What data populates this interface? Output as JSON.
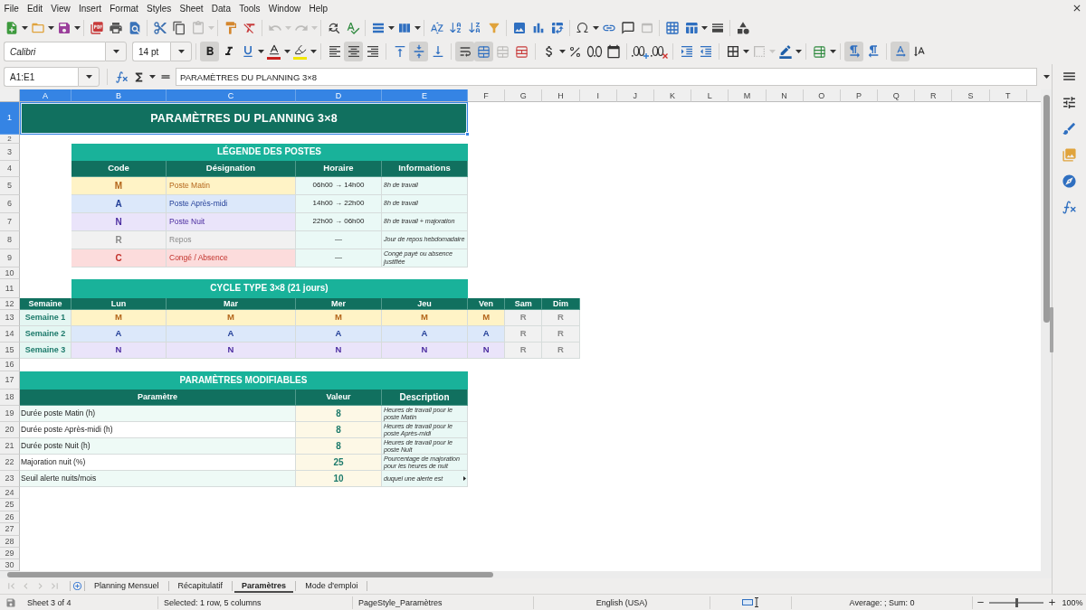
{
  "menu_bar": [
    "File",
    "Edit",
    "View",
    "Insert",
    "Format",
    "Styles",
    "Sheet",
    "Data",
    "Tools",
    "Window",
    "Help"
  ],
  "standard_toolbar": [
    [
      {
        "kind": "new",
        "disabled": false
      },
      {
        "kind": "open",
        "disabled": false
      },
      {
        "kind": "save",
        "disabled": false
      }
    ],
    [
      {
        "kind": "export_pdf",
        "disabled": false
      },
      {
        "kind": "print",
        "disabled": false
      },
      {
        "kind": "print_preview",
        "disabled": false
      }
    ],
    [
      {
        "kind": "cut",
        "disabled": false
      },
      {
        "kind": "copy",
        "disabled": false
      },
      {
        "kind": "paste",
        "disabled": true
      }
    ],
    [
      {
        "kind": "clone_formatting",
        "disabled": false
      },
      {
        "kind": "clear_formatting",
        "disabled": false
      }
    ],
    [
      {
        "kind": "undo",
        "disabled": true
      },
      {
        "kind": "redo",
        "disabled": true
      }
    ],
    [
      {
        "kind": "find_replace",
        "disabled": false
      },
      {
        "kind": "spelling",
        "disabled": false
      }
    ],
    [
      {
        "kind": "row",
        "disabled": false
      },
      {
        "kind": "column",
        "disabled": false
      }
    ],
    [
      {
        "kind": "sort",
        "disabled": false
      },
      {
        "kind": "sort_ascending",
        "disabled": false
      },
      {
        "kind": "sort_descending",
        "disabled": false
      },
      {
        "kind": "autofilter",
        "disabled": false
      }
    ],
    [
      {
        "kind": "image",
        "disabled": false
      },
      {
        "kind": "chart",
        "disabled": false
      },
      {
        "kind": "pivot_table",
        "disabled": false
      }
    ],
    [
      {
        "kind": "special_character",
        "disabled": false
      },
      {
        "kind": "hyperlink",
        "disabled": false
      },
      {
        "kind": "comment",
        "disabled": false
      },
      {
        "kind": "header_footer",
        "disabled": true
      }
    ],
    [
      {
        "kind": "print_area",
        "disabled": false
      },
      {
        "kind": "freeze",
        "disabled": false
      },
      {
        "kind": "split_window",
        "disabled": false
      }
    ],
    [
      {
        "kind": "draw_functions",
        "disabled": false
      }
    ]
  ],
  "formatting_toolbar": {
    "font_name": "Calibri",
    "font_size": "14 pt",
    "tools": [
      [
        {
          "kind": "bold",
          "on": true,
          "disabled": false
        },
        {
          "kind": "italic",
          "on": false,
          "disabled": false
        },
        {
          "kind": "underline",
          "on": false,
          "disabled": false
        },
        {
          "kind": "font_color",
          "on": false,
          "disabled": false
        },
        {
          "kind": "highlight",
          "on": false,
          "disabled": false
        }
      ],
      [
        {
          "kind": "align_left",
          "on": false,
          "disabled": false
        },
        {
          "kind": "align_center",
          "on": true,
          "disabled": false
        },
        {
          "kind": "align_right",
          "on": false,
          "disabled": false
        }
      ],
      [
        {
          "kind": "align_top",
          "on": false,
          "disabled": false
        },
        {
          "kind": "align_middle",
          "on": true,
          "disabled": false
        },
        {
          "kind": "align_bottom",
          "on": false,
          "disabled": false
        }
      ],
      [
        {
          "kind": "wrap_text",
          "on": true,
          "disabled": false
        },
        {
          "kind": "merge_center",
          "on": true,
          "disabled": false
        },
        {
          "kind": "merge_cells",
          "on": false,
          "disabled": true
        },
        {
          "kind": "unmerge_cells",
          "on": false,
          "disabled": false
        }
      ],
      [
        {
          "kind": "currency",
          "on": false,
          "disabled": false
        },
        {
          "kind": "percent",
          "on": false,
          "disabled": false
        },
        {
          "kind": "number",
          "on": false,
          "disabled": false
        },
        {
          "kind": "date",
          "on": false,
          "disabled": false
        }
      ],
      [
        {
          "kind": "add_decimal",
          "on": false,
          "disabled": false
        },
        {
          "kind": "delete_decimal",
          "on": false,
          "disabled": false
        }
      ],
      [
        {
          "kind": "increase_indent",
          "on": false,
          "disabled": false
        },
        {
          "kind": "decrease_indent",
          "on": false,
          "disabled": false
        }
      ],
      [
        {
          "kind": "borders",
          "on": false,
          "disabled": false
        },
        {
          "kind": "border_style",
          "on": false,
          "disabled": true
        },
        {
          "kind": "border_color",
          "on": false,
          "disabled": false
        }
      ],
      [
        {
          "kind": "conditional",
          "on": false,
          "disabled": false
        }
      ],
      [
        {
          "kind": "left_to_right",
          "on": true,
          "disabled": false
        },
        {
          "kind": "right_to_left",
          "on": false,
          "disabled": false
        }
      ],
      [
        {
          "kind": "horizontal_text",
          "on": true,
          "disabled": false
        },
        {
          "kind": "vertical_text",
          "on": false,
          "disabled": false
        }
      ]
    ]
  },
  "formula_bar": {
    "name_box": "A1:E1",
    "content": "PARAMÈTRES DU PLANNING 3×8"
  },
  "sheet": {
    "column_headers": [
      {
        "label": "A",
        "selected": true
      },
      {
        "label": "B",
        "selected": true
      },
      {
        "label": "C",
        "selected": true
      },
      {
        "label": "D",
        "selected": true
      },
      {
        "label": "E",
        "selected": true
      },
      {
        "label": "F",
        "selected": false
      },
      {
        "label": "G",
        "selected": false
      },
      {
        "label": "H",
        "selected": false
      },
      {
        "label": "I",
        "selected": false
      },
      {
        "label": "J",
        "selected": false
      },
      {
        "label": "K",
        "selected": false
      },
      {
        "label": "L",
        "selected": false
      },
      {
        "label": "M",
        "selected": false
      },
      {
        "label": "N",
        "selected": false
      },
      {
        "label": "O",
        "selected": false
      },
      {
        "label": "P",
        "selected": false
      },
      {
        "label": "Q",
        "selected": false
      },
      {
        "label": "R",
        "selected": false
      },
      {
        "label": "S",
        "selected": false
      },
      {
        "label": "T",
        "selected": false
      }
    ],
    "row_headers": [
      {
        "label": "1",
        "selected": true
      },
      {
        "label": "2",
        "selected": false
      },
      {
        "label": "3",
        "selected": false
      },
      {
        "label": "4",
        "selected": false
      },
      {
        "label": "5",
        "selected": false
      },
      {
        "label": "6",
        "selected": false
      },
      {
        "label": "7",
        "selected": false
      },
      {
        "label": "8",
        "selected": false
      },
      {
        "label": "9",
        "selected": false
      },
      {
        "label": "10",
        "selected": false
      },
      {
        "label": "11",
        "selected": false
      },
      {
        "label": "12",
        "selected": false
      },
      {
        "label": "13",
        "selected": false
      },
      {
        "label": "14",
        "selected": false
      },
      {
        "label": "15",
        "selected": false
      },
      {
        "label": "16",
        "selected": false
      },
      {
        "label": "17",
        "selected": false
      },
      {
        "label": "18",
        "selected": false
      },
      {
        "label": "19",
        "selected": false
      },
      {
        "label": "20",
        "selected": false
      },
      {
        "label": "21",
        "selected": false
      },
      {
        "label": "22",
        "selected": false
      },
      {
        "label": "23",
        "selected": false
      },
      {
        "label": "24",
        "selected": false
      },
      {
        "label": "25",
        "selected": false
      },
      {
        "label": "26",
        "selected": false
      },
      {
        "label": "27",
        "selected": false
      },
      {
        "label": "28",
        "selected": false
      },
      {
        "label": "29",
        "selected": false
      },
      {
        "label": "30",
        "selected": false
      }
    ],
    "title": {
      "text": "PARAMÈTRES DU PLANNING 3×8",
      "selected": true
    },
    "legend": {
      "title": "LÉGENDE DES POSTES",
      "headers": [
        "Code",
        "Désignation",
        "Horaire",
        "Informations"
      ],
      "rows": [
        {
          "kind": "morning",
          "code": "M",
          "designation": "Poste Matin",
          "hours": "06h00 → 14h00",
          "info": "8h de travail"
        },
        {
          "kind": "afternoon",
          "code": "A",
          "designation": "Poste Après-midi",
          "hours": "14h00 → 22h00",
          "info": "8h de travail"
        },
        {
          "kind": "night",
          "code": "N",
          "designation": "Poste Nuit",
          "hours": "22h00 → 06h00",
          "info": "8h de travail + majoration"
        },
        {
          "kind": "rest",
          "code": "R",
          "designation": "Repos",
          "hours": "—",
          "info": "Jour de repos hebdomadaire"
        },
        {
          "kind": "leave",
          "code": "C",
          "designation": "Congé / Absence",
          "hours": "—",
          "info": "Congé payé ou absence justifiée"
        }
      ]
    },
    "cycle": {
      "title": "CYCLE TYPE 3×8 (21 jours)",
      "headers": [
        "Semaine",
        "Lun",
        "Mar",
        "Mer",
        "Jeu",
        "Ven",
        "Sam",
        "Dim"
      ],
      "weeks": [
        {
          "label": "Semaine 1",
          "days": [
            {
              "kind": "morning",
              "code": "M"
            },
            {
              "kind": "morning",
              "code": "M"
            },
            {
              "kind": "morning",
              "code": "M"
            },
            {
              "kind": "morning",
              "code": "M"
            },
            {
              "kind": "morning",
              "code": "M"
            },
            {
              "kind": "rest",
              "code": "R"
            },
            {
              "kind": "rest",
              "code": "R"
            }
          ]
        },
        {
          "label": "Semaine 2",
          "days": [
            {
              "kind": "afternoon",
              "code": "A"
            },
            {
              "kind": "afternoon",
              "code": "A"
            },
            {
              "kind": "afternoon",
              "code": "A"
            },
            {
              "kind": "afternoon",
              "code": "A"
            },
            {
              "kind": "afternoon",
              "code": "A"
            },
            {
              "kind": "rest",
              "code": "R"
            },
            {
              "kind": "rest",
              "code": "R"
            }
          ]
        },
        {
          "label": "Semaine 3",
          "days": [
            {
              "kind": "night",
              "code": "N"
            },
            {
              "kind": "night",
              "code": "N"
            },
            {
              "kind": "night",
              "code": "N"
            },
            {
              "kind": "night",
              "code": "N"
            },
            {
              "kind": "night",
              "code": "N"
            },
            {
              "kind": "rest",
              "code": "R"
            },
            {
              "kind": "rest",
              "code": "R"
            }
          ]
        }
      ]
    },
    "parameters": {
      "title": "PARAMÈTRES MODIFIABLES",
      "headers": [
        "Paramètre",
        "Valeur",
        "Description"
      ],
      "rows": [
        {
          "name": "Durée poste Matin (h)",
          "value": "8",
          "description": "Heures de travail pour le poste Matin",
          "overflow": false
        },
        {
          "name": "Durée poste Après-midi (h)",
          "value": "8",
          "description": "Heures de travail pour le poste Après-midi",
          "overflow": false
        },
        {
          "name": "Durée poste Nuit (h)",
          "value": "8",
          "description": "Heures de travail pour le poste Nuit",
          "overflow": false
        },
        {
          "name": "Majoration nuit (%)",
          "value": "25",
          "description": "Pourcentage de majoration pour les heures de nuit",
          "overflow": false
        },
        {
          "name": "Seuil alerte nuits/mois",
          "value": "10",
          "description": "duquel une alerte est",
          "overflow": true
        }
      ]
    }
  },
  "sheet_tabs": [
    {
      "label": "Planning Mensuel",
      "selected": false
    },
    {
      "label": "Récapitulatif",
      "selected": false
    },
    {
      "label": "Paramètres",
      "selected": true
    },
    {
      "label": "Mode d'emploi",
      "selected": false
    }
  ],
  "status_bar": {
    "sheet": "Sheet 3 of 4",
    "selection": "Selected: 1 row, 5 columns",
    "page_style": "PageStyle_Paramètres",
    "language": "English (USA)",
    "summary": "Average: ; Sum: 0",
    "zoom_slider": {
      "level": 0.5
    },
    "zoom": "100%"
  }
}
